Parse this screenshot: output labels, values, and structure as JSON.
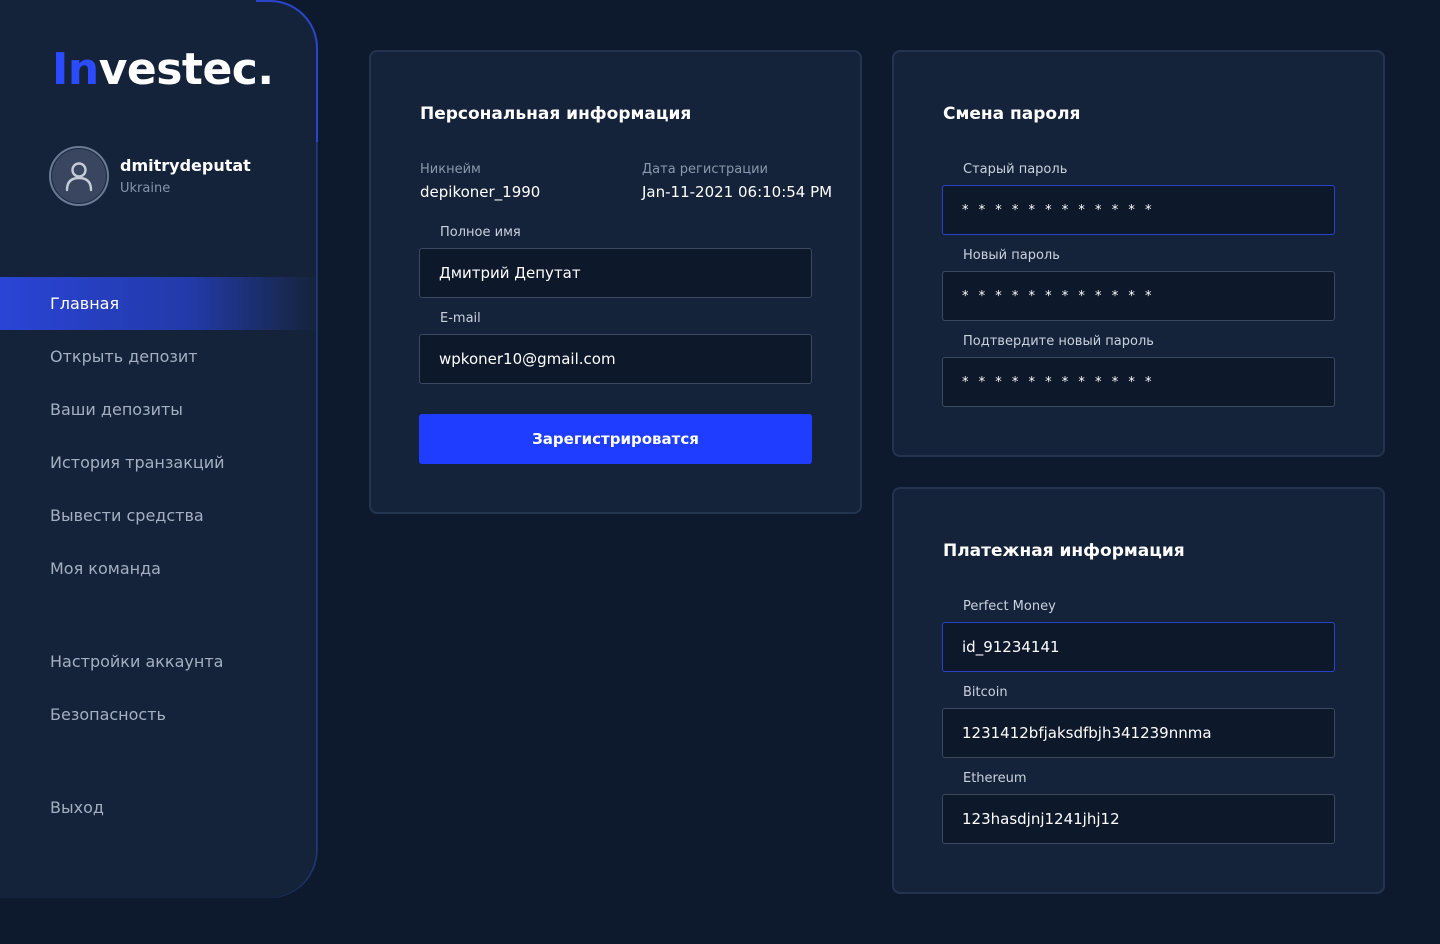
{
  "brand": {
    "logo_first": "In",
    "logo_rest": "vestec."
  },
  "user": {
    "name": "dmitrydeputat",
    "country": "Ukraine"
  },
  "nav": {
    "items": [
      {
        "label": "Главная"
      },
      {
        "label": "Открыть депозит"
      },
      {
        "label": "Ваши депозиты"
      },
      {
        "label": "История транзакций"
      },
      {
        "label": "Вывести средства"
      },
      {
        "label": "Моя команда"
      },
      {
        "label": "Настройки аккаунта"
      },
      {
        "label": "Безопасность"
      },
      {
        "label": "Выход"
      }
    ]
  },
  "personal": {
    "title": "Персональная информация",
    "nickname_label": "Никнейм",
    "nickname": "depikoner_1990",
    "reg_label": "Дата регистрации",
    "reg_date": "Jan-11-2021 06:10:54 PM",
    "fullname_label": "Полное имя",
    "fullname": "Дмитрий Депутат",
    "email_label": "E-mail",
    "email": "wpkoner10@gmail.com",
    "submit_label": "Зарегистрироватся"
  },
  "password": {
    "title": "Смена пароля",
    "old_label": "Старый пароль",
    "old_value": "* * * * * * * * * * * *",
    "new_label": "Новый пароль",
    "new_value": "* * * * * * * * * * * *",
    "confirm_label": "Подтвердите новый пароль",
    "confirm_value": "* * * * * * * * * * * *"
  },
  "payment": {
    "title": "Платежная информация",
    "pm_label": "Perfect Money",
    "pm_value": "id_91234141",
    "btc_label": "Bitcoin",
    "btc_value": "1231412bfjaksdfbjh341239nnma",
    "eth_label": "Ethereum",
    "eth_value": "123hasdjnj1241jhj12"
  },
  "colors": {
    "accent": "#1f3dff",
    "background": "#0d1a2e",
    "panel": "#15233a"
  }
}
